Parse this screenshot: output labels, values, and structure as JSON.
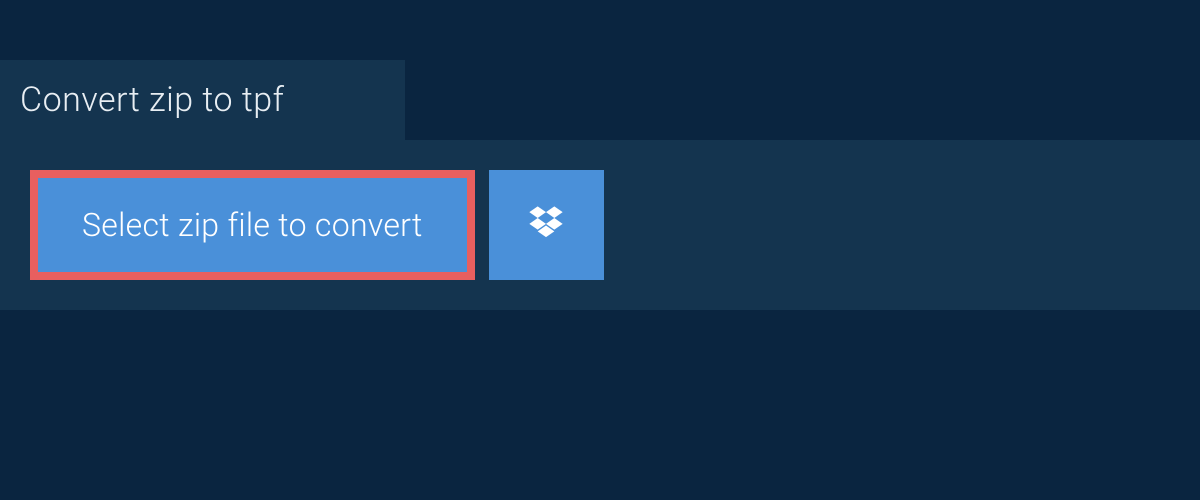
{
  "header": {
    "title": "Convert zip to tpf"
  },
  "actions": {
    "select_file_label": "Select zip file to convert",
    "dropbox_icon": "dropbox-icon"
  },
  "colors": {
    "background": "#0a2540",
    "panel": "#14344f",
    "button": "#4a90d9",
    "highlight_border": "#e85f5f",
    "text_light": "#e8eef3",
    "text_button": "#ffffff"
  }
}
